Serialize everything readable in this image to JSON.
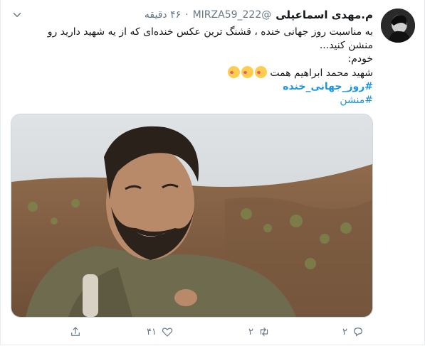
{
  "tweet": {
    "display_name": "م.مهدی اسماعیلی",
    "handle": "@MIRZA59_222",
    "separator": "·",
    "time": "۴۶ دقیقه",
    "lines": [
      "به مناسبت روز جهانی خنده ، قشنگ ترین عکس خنده‌ای که از یه شهید دارید رو",
      "منشن کنید...",
      "خودم:",
      "شهید محمد ابراهیم همت"
    ],
    "hashtags": [
      "#روز_جهانی_خنده",
      "#منشن"
    ]
  },
  "actions": {
    "reply_count": "۲",
    "retweet_count": "۲",
    "like_count": "۴۱"
  },
  "icons": {
    "reply": "reply-icon",
    "retweet": "retweet-icon",
    "like": "heart-icon",
    "share": "share-icon",
    "more": "chevron-down-icon",
    "emoji": "face-blowing-kiss-emoji"
  },
  "colors": {
    "link": "#1b95e0",
    "muted": "#657786",
    "text": "#14171a"
  }
}
